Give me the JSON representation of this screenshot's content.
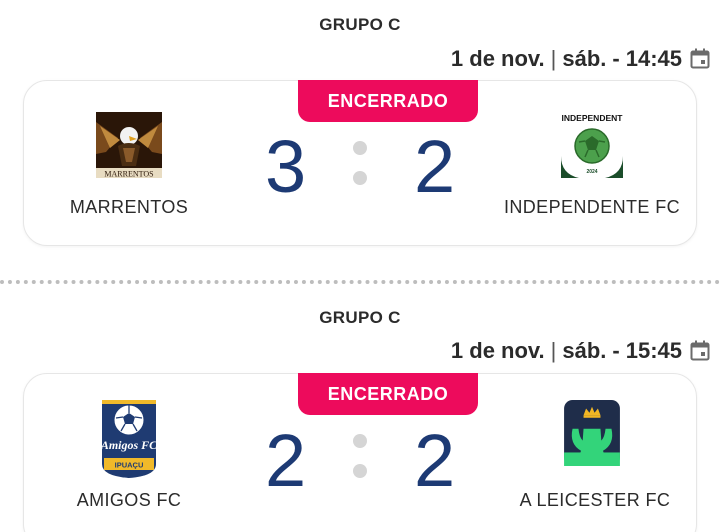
{
  "matches": [
    {
      "group": "GRUPO C",
      "date": "1 de nov.",
      "weekday": "sáb.",
      "time": "14:45",
      "status": "ENCERRADO",
      "home": {
        "name": "MARRENTOS",
        "logo_text": "MARRENTOS",
        "score": "3"
      },
      "away": {
        "name": "INDEPENDENTE FC",
        "logo_text": "INDEPENDENT",
        "logo_year": "2024",
        "score": "2"
      }
    },
    {
      "group": "GRUPO C",
      "date": "1 de nov.",
      "weekday": "sáb.",
      "time": "15:45",
      "status": "ENCERRADO",
      "home": {
        "name": "AMIGOS FC",
        "logo_text": "Amigos FC",
        "logo_subtext": "IPUAÇU",
        "score": "2"
      },
      "away": {
        "name": "A LEICESTER FC",
        "score": "2"
      }
    }
  ],
  "separator": "|",
  "dash": "-",
  "colors": {
    "badge": "#ed0b5c",
    "score": "#1d3a74",
    "text": "#2b2b2b",
    "border": "#e6e6e6"
  }
}
